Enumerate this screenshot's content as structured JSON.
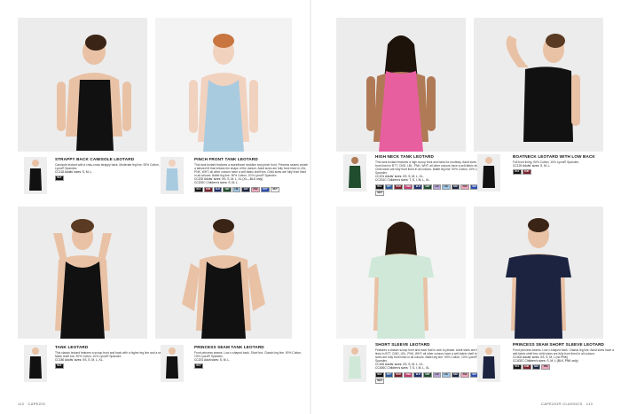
{
  "footer": {
    "left_page": "112",
    "left_brand": "CAPEZIO",
    "right_brand": "CAPEZIO® CLASSICS",
    "right_page": "113"
  },
  "products": [
    {
      "title": "STRAPPY BACK CAMISOLE LEOTARD",
      "desc": "Camisole leotard with a criss-cross strappy back. Moderate leg line. 90% Cotton, 10% Lycra® Spandex.",
      "sizes": "CC118 Adults' sizes: S, M, L.",
      "swatches": [
        {
          "code": "BLK",
          "color": "#111111"
        }
      ],
      "garment": "#111111"
    },
    {
      "title": "PINCH FRONT TANK LEOTARD",
      "desc": "This tank leotard features a sweetheart neckline and pinch front. Princess seams create a tailored fit that follows the shape of the dancer. Adult sizes are fully front lined in LBL, PNK, WHT; all other colours have a self-fabric shelf bra. Child sizes are fully front lined in all colours. Ballet leg line. 90% Cotton, 10% Lycra® Spandex.",
      "sizes": "CC202 Adults' sizes: XS, S, M, L, XL (XL—BLK only)\nCC202C Children's sizes: S, M, L.",
      "swatches": [
        {
          "code": "BLK",
          "color": "#111111"
        },
        {
          "code": "BUR",
          "color": "#7a1f2b"
        },
        {
          "code": "ELR",
          "color": "#1e2f6f"
        },
        {
          "code": "HNT",
          "color": "#1f4d2e"
        },
        {
          "code": "LBL",
          "color": "#9dc6e6"
        },
        {
          "code": "NAV",
          "color": "#1b2340"
        },
        {
          "code": "PNK",
          "color": "#f1a7bd"
        },
        {
          "code": "ROY",
          "color": "#2a4db0"
        },
        {
          "code": "WHT",
          "color": "#f5f5f5"
        }
      ],
      "garment": "#a9cbe0"
    },
    {
      "title": "TANK LEOTARD",
      "desc": "This classic leotard features a scoop front and back with a higher leg line and a self-fabric shelf bra. 90% Cotton, 10% Lycra® Spandex.",
      "sizes": "CC180 Adults' sizes: XS, S, M, L, XL.",
      "swatches": [
        {
          "code": "BLK",
          "color": "#111111"
        }
      ],
      "garment": "#111111"
    },
    {
      "title": "PRINCESS SEAM TANK LEOTARD",
      "desc": "Front princess seams. Low v-shaped back. Short bra. Classic leg line. 90% Cotton, 10% Lycra® Spandex.",
      "sizes": "CC201 Adult sizes: S, M, L.",
      "swatches": [
        {
          "code": "BLK",
          "color": "#111111"
        }
      ],
      "garment": "#111111"
    },
    {
      "title": "HIGH NECK TANK LEOTARD",
      "desc": "This tank leotard features a high scoop front and back for modesty. Adult sizes are fully front lined in BTT, CMG, LBL, PNK, WHT; all other colours have a self-fabric shelf bra. Child sizes are fully front lined in all colours. Ballet leg line. 90% Cotton, 10% Lycra® Spandex.",
      "sizes": "CC201 Adults' sizes: XS, S, M, L, XL.\nCC201C Children's sizes: T, S, I, M, L, XL.",
      "swatches": [
        {
          "code": "BLK",
          "color": "#111111"
        },
        {
          "code": "BTT",
          "color": "#2a5a9a"
        },
        {
          "code": "BUR",
          "color": "#7a1f2b"
        },
        {
          "code": "CMG",
          "color": "#c23c6e"
        },
        {
          "code": "ELR",
          "color": "#1e2f6f"
        },
        {
          "code": "HNT",
          "color": "#1f4d2e"
        },
        {
          "code": "LAV",
          "color": "#b9a4d8"
        },
        {
          "code": "LBL",
          "color": "#9dc6e6"
        },
        {
          "code": "NAV",
          "color": "#1b2340"
        },
        {
          "code": "PNK",
          "color": "#f1a7bd"
        },
        {
          "code": "ROY",
          "color": "#2a4db0"
        },
        {
          "code": "WHT",
          "color": "#f5f5f5"
        }
      ],
      "garment": "#e85fa0"
    },
    {
      "title": "BOATNECK LEOTARD WITH LOW BACK",
      "desc": "Full front lining. 90% Cotton, 10% Lycra® Spandex.",
      "sizes": "CC120 Adults' sizes: S, M, L.",
      "swatches": [
        {
          "code": "BLK",
          "color": "#111111"
        },
        {
          "code": "BUR",
          "color": "#7a1f2b"
        }
      ],
      "garment": "#111111"
    },
    {
      "title": "SHORT SLEEVE LEOTARD",
      "desc": "Features a classic scoop front and back that is cute to please. Adult sizes are fully front lined in BTT, CMG, LBL, PNK, WHT; all other colours have a self-fabric shelf bra. Child sizes are fully front lined in all colours. Ballet leg line. 90% Cotton, 10% Lycra® Spandex.",
      "sizes": "CC400 Adults' sizes: XS, S, M, L, XL.\nCC400C Children's sizes: T, S, I, M, L, XL.",
      "swatches": [
        {
          "code": "BLK",
          "color": "#111111"
        },
        {
          "code": "BTT",
          "color": "#2a5a9a"
        },
        {
          "code": "BUR",
          "color": "#7a1f2b"
        },
        {
          "code": "CMG",
          "color": "#c23c6e"
        },
        {
          "code": "ELR",
          "color": "#1e2f6f"
        },
        {
          "code": "HNT",
          "color": "#1f4d2e"
        },
        {
          "code": "LAV",
          "color": "#b9a4d8"
        },
        {
          "code": "LBL",
          "color": "#9dc6e6"
        },
        {
          "code": "NAV",
          "color": "#1b2340"
        },
        {
          "code": "PNK",
          "color": "#f1a7bd"
        },
        {
          "code": "ROY",
          "color": "#2a4db0"
        },
        {
          "code": "WHT",
          "color": "#f5f5f5"
        }
      ],
      "garment": "#cfe8d8"
    },
    {
      "title": "PRINCESS SEAM SHORT SLEEVE LEOTARD",
      "desc": "Front princess seams. Low v-shaped back. Classic leg line. Adult sizes have a self-fabric shelf bra; child sizes are fully front lined in all colours.",
      "sizes": "CC402 Adults' sizes: XS, S, M, L (no PNK)\nCC402C Children's sizes: S, M, L (BLK, PNK only)",
      "swatches": [
        {
          "code": "BLK",
          "color": "#111111"
        },
        {
          "code": "BUR",
          "color": "#7a1f2b"
        },
        {
          "code": "NAV",
          "color": "#1b2340"
        },
        {
          "code": "PNK",
          "color": "#f1a7bd"
        }
      ],
      "garment": "#1b2340"
    }
  ]
}
